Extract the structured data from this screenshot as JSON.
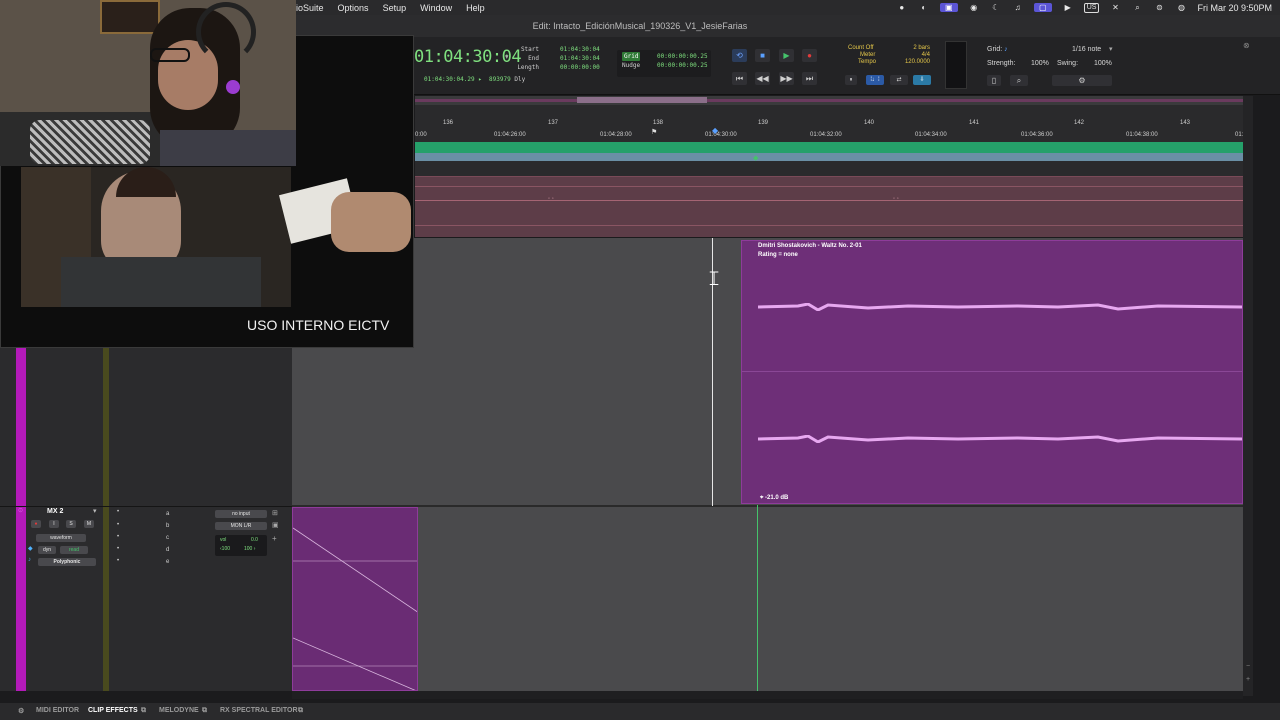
{
  "menubar": {
    "items": [
      "ioSuite",
      "Options",
      "Setup",
      "Window",
      "Help"
    ],
    "keyboard": "US",
    "clock": "Fri Mar 20  9:50PM"
  },
  "window": {
    "title": "Edit: Intacto_EdiciónMusical_190326_V1_JesieFarias"
  },
  "transport": {
    "main_counter": "01:04:30:04",
    "sub_counter": "01:04:30:04.29",
    "sub_value": "893979",
    "sub_dly": "Dly",
    "start_label": "Start",
    "start_value": "01:04:30:04",
    "end_label": "End",
    "end_value": "01:04:30:04",
    "length_label": "Length",
    "length_value": "00:00:00:00",
    "grid_label": "Grid",
    "grid_value": "00:00:00:00.25",
    "nudge_label": "Nudge",
    "nudge_value": "00:00:00:00.25",
    "count_off": "Count Off",
    "count_off_value": "2 bars",
    "meter": "Meter",
    "meter_value": "4/4",
    "tempo": "Tempo",
    "tempo_value": "120.0000",
    "grid_note_label": "Grid:",
    "grid_note": "1/16 note",
    "strength_label": "Strength:",
    "strength_value": "100%",
    "swing_label": "Swing:",
    "swing_value": "100%"
  },
  "ruler": {
    "bars": [
      "136",
      "137",
      "138",
      "139",
      "140",
      "141",
      "142",
      "143"
    ],
    "timecodes": [
      "01:04:26:00",
      "01:04:28:00",
      "01:04:30:00",
      "01:04:32:00",
      "01:04:34:00",
      "01:04:36:00",
      "01:04:38:00"
    ],
    "left_partial": "0:00",
    "right_partial": "01:"
  },
  "clip": {
    "name": "Dmitri Shostakovich - Waltz No. 2-01",
    "rating": "Rating = none",
    "gain": "-21.0 dB"
  },
  "track": {
    "name": "MX 2",
    "rec": "●",
    "input_mon": "I",
    "solo": "S",
    "mute": "M",
    "view": "waveform",
    "dyn": "dyn",
    "read": "read",
    "elastic": "Polyphonic",
    "input": "no input",
    "output": "MON L/R",
    "vol_label": "vol",
    "vol_value": "0.0",
    "pan_left": "‹100",
    "pan_right": "100 ›",
    "inserts": [
      "a",
      "b",
      "c",
      "d",
      "e"
    ]
  },
  "video_overlay": {
    "caption": "USO INTERNO EICTV"
  },
  "bottom_tabs": [
    "MIDI EDITOR",
    "CLIP EFFECTS",
    "MELODYNE",
    "RX SPECTRAL EDITOR"
  ],
  "colors": {
    "clip_purple": "#6e2f78",
    "track_color": "#b31ab9",
    "counter_green": "#7fe07f",
    "marker_green": "#25a06a"
  }
}
